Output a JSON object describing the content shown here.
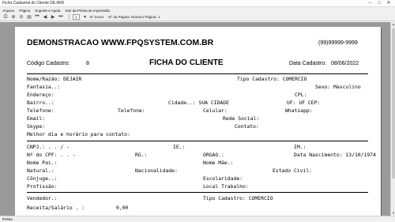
{
  "window": {
    "title": "Ficha Cadastral do Cliente DEJAIR"
  },
  "menu": [
    "Arquivo",
    "Página",
    "Suporte e Ajuda",
    "Sair da Prévia de Impressão"
  ],
  "toolbar": {
    "page_select": "1",
    "zoom_label": "Nº Zoom",
    "page_info": "Nº da Página: Número Página: 1"
  },
  "status": {
    "text": "Prévia"
  },
  "report": {
    "company": "DEMONSTRACAO WWW.FPQSYSTEM.COM.BR",
    "phone": "(99)99999-9999",
    "code_label": "Código Cadastro:",
    "code_value": "8",
    "title": "FICHA DO CLIENTE",
    "date_label": "Data Cadastro:",
    "date_value": "08/06/2022",
    "rows1": [
      {
        "l": "Nome/Razão: DEJAIR",
        "m": "",
        "r": "Tipo Cadastro: COMERCIO"
      },
      {
        "l": "Fantasia..:",
        "m": "",
        "r": "Sexo: Masculino"
      },
      {
        "l": "Endereço:",
        "m": "",
        "r": "CPL:"
      },
      {
        "l": "Bairro..:",
        "m": "Cidade..: SUA CIDADE",
        "r": "UF: UF   CEP:"
      },
      {
        "l": "Telefone:",
        "m": "Telefone:",
        "m2": "Celular:",
        "r": "Whatsapp:"
      },
      {
        "l": "Email:",
        "m": "",
        "r": "Rede Social:"
      },
      {
        "l": "Skype:",
        "m": "",
        "r": "Contato:"
      },
      {
        "l": "Melhor dia e horário para contato:",
        "m": "",
        "r": ""
      }
    ],
    "rows2": [
      {
        "l": "CNPJ.:   .   .   /   -",
        "m": "IE.:",
        "r": "IM.:"
      },
      {
        "l": "Nº do CPF:    .   .   -",
        "m": "RG.:",
        "m2": "ORGAO.:",
        "r": "Data Nascimento: 13/10/1974"
      },
      {
        "l": "Nome Pai.:",
        "m": "",
        "r": "Nome Mãe.:"
      },
      {
        "l": "Natural.:",
        "m": "Nacionalidade:",
        "r": "Estado Civil:"
      },
      {
        "l": "Cônjuge..:",
        "m": "",
        "r": "Escolaridade:"
      },
      {
        "l": "Profissão:",
        "m": "",
        "r": "Local Trabalho:"
      }
    ],
    "rows3": [
      {
        "l": "Vendedor.:",
        "m": "",
        "r": "Tipo Cadastro: COMERCIO"
      },
      {
        "l": "Receita/Salário . :",
        "m": "0,00",
        "r": ""
      }
    ]
  }
}
